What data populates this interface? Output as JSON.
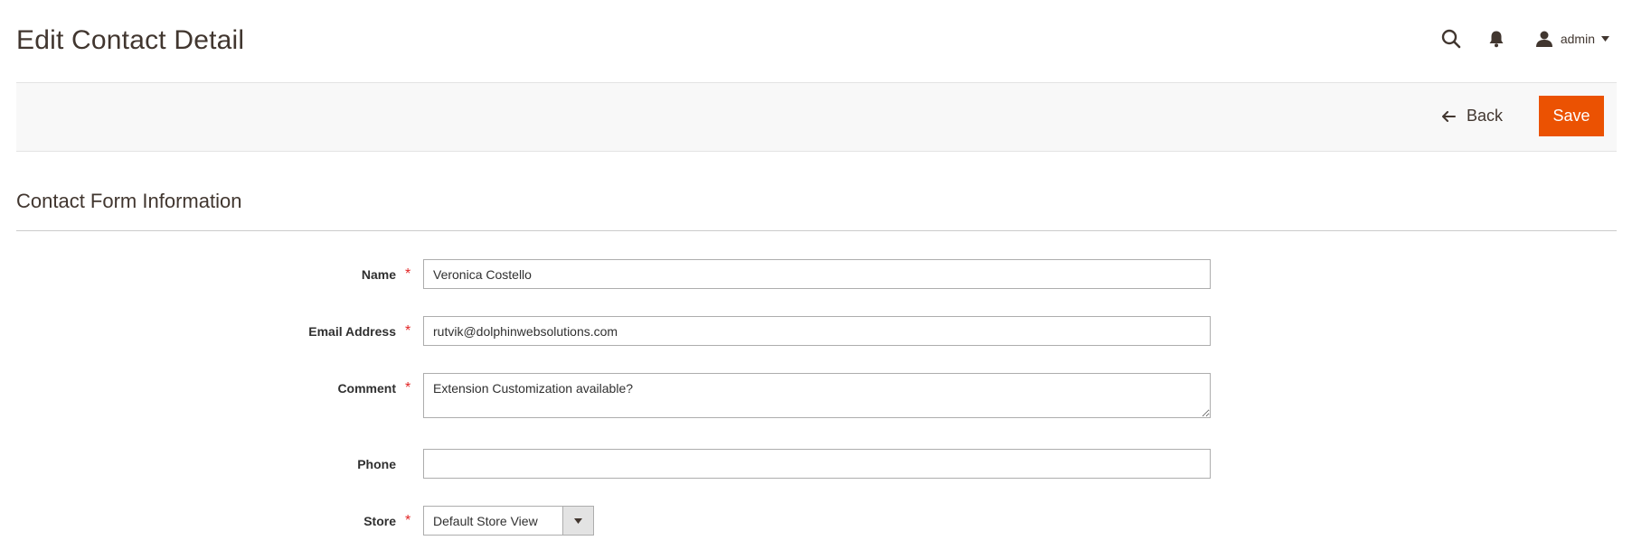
{
  "header": {
    "title": "Edit Contact Detail",
    "user_name": "admin",
    "icons": {
      "search": "search-icon",
      "notifications": "bell-icon",
      "user": "user-icon",
      "user_caret": "caret-down-icon"
    }
  },
  "actions": {
    "back_label": "Back",
    "save_label": "Save",
    "accent_color": "#eb5202"
  },
  "section": {
    "title": "Contact Form Information"
  },
  "form": {
    "name": {
      "label": "Name",
      "value": "Veronica Costello",
      "required": true
    },
    "email": {
      "label": "Email Address",
      "value": "rutvik@dolphinwebsolutions.com",
      "required": true
    },
    "comment": {
      "label": "Comment",
      "value": "Extension Customization available?",
      "required": true
    },
    "phone": {
      "label": "Phone",
      "value": "",
      "required": false
    },
    "store": {
      "label": "Store",
      "selected": "Default Store View",
      "required": true
    },
    "required_marker": "*"
  }
}
